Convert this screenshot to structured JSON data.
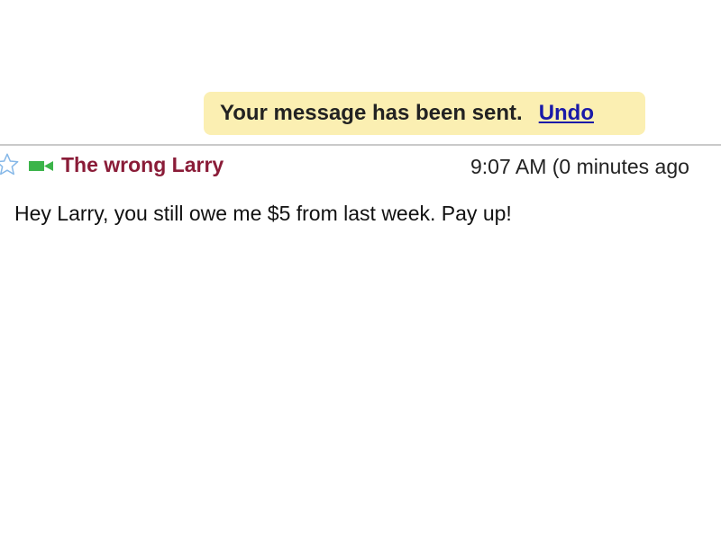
{
  "notification": {
    "text": "Your message has been sent.",
    "undo_label": "Undo"
  },
  "message": {
    "sender": "The wrong Larry",
    "time": "9:07 AM (0 minutes ago",
    "body": "Hey Larry, you still owe me $5 from last week. Pay up!",
    "icons": {
      "star": "star-outline-icon",
      "video": "video-chat-icon"
    }
  },
  "colors": {
    "notification_bg": "#fbefb2",
    "sender": "#8a1c38",
    "link": "#1a1aa8",
    "video_icon": "#3cb44a",
    "star_outline": "#86b8e8",
    "divider": "#c9c9c9"
  }
}
